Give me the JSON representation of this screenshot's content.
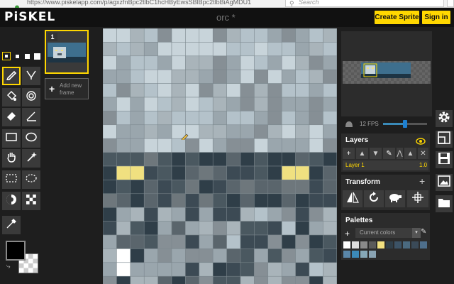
{
  "browser": {
    "url": "https://www.piskelapp.com/p/agxzfnBpc2tlbC1hcHByEwsSBlBpc2tlbBiAgMDU1",
    "search_placeholder": "Search"
  },
  "header": {
    "logo": "PiSKEL",
    "title": "orc *",
    "create_sprite": "Create Sprite",
    "sign_in": "Sign in"
  },
  "frames": {
    "frame_number": "1",
    "add_frame": "Add new frame"
  },
  "preview": {
    "fps_label": "12 FPS",
    "fps_value": 12,
    "fps_slider_fraction": 0.5
  },
  "layers": {
    "title": "Layers",
    "items": [
      {
        "name": "Layer 1",
        "opacity": "1.0"
      }
    ]
  },
  "transform": {
    "title": "Transform"
  },
  "palettes": {
    "title": "Palettes",
    "selected": "Current colors",
    "colors": [
      "#ffffff",
      "#dddddd",
      "#8a8a8a",
      "#5a5a5a",
      "#f0e080",
      "#2f3e48",
      "#3c5366",
      "#4a6a80",
      "#3a4a58",
      "#4e6f8c",
      "#5a86a8",
      "#3c8ab8",
      "#86a8b8",
      "#8aa4b4"
    ]
  },
  "colors": {
    "primary": "#000000",
    "accent": "#ffd700"
  }
}
